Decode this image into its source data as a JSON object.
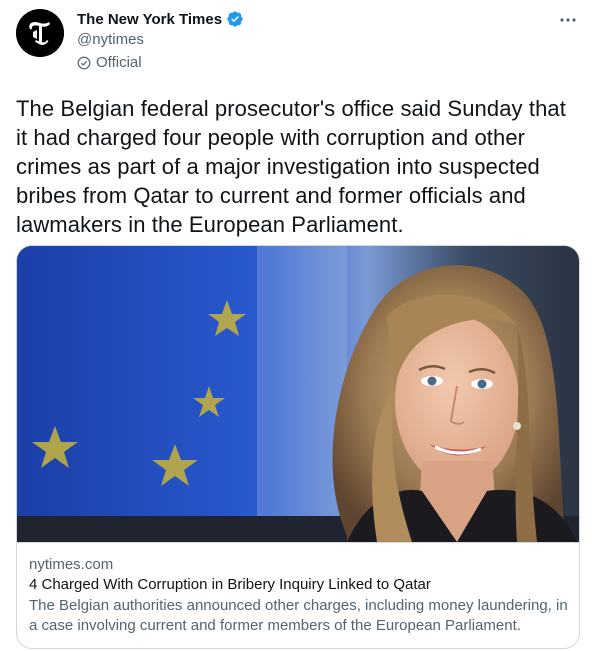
{
  "account": {
    "display_name": "The New York Times",
    "handle": "@nytimes",
    "official_label": "Official",
    "verified": true
  },
  "tweet": {
    "text": "The Belgian federal prosecutor's office said Sunday that it had charged four people with corruption and other crimes as part of a major investigation into suspected bribes from Qatar to current and former officials and lawmakers in the European Parliament."
  },
  "card": {
    "domain": "nytimes.com",
    "title": "4 Charged With Corruption in Bribery Inquiry Linked to Qatar",
    "description": "The Belgian authorities announced other charges, including money laundering, in a case involving current and former members of the European Parliament."
  },
  "icons": {
    "verified": "verified-badge-icon",
    "official": "official-check-icon",
    "more": "more-options-icon"
  },
  "colors": {
    "text_primary": "#0f1419",
    "text_secondary": "#536471",
    "verified_blue": "#1d9bf0",
    "border": "#cfd9de"
  }
}
